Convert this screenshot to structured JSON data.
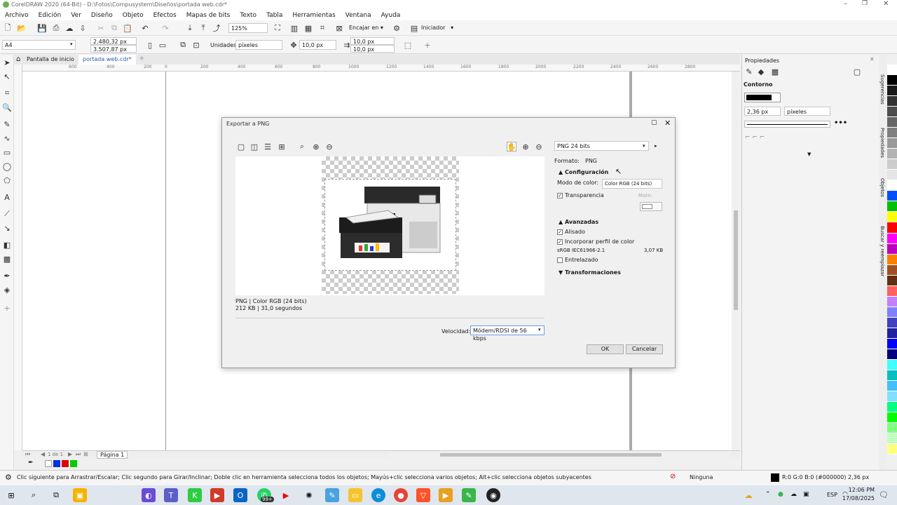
{
  "window": {
    "title": "CorelDRAW 2020 (64-Bit) - D:\\Fotos\\Compusystem\\Diseños\\portada web.cdr*"
  },
  "menu": [
    "Archivo",
    "Edición",
    "Ver",
    "Diseño",
    "Objeto",
    "Efectos",
    "Mapas de bits",
    "Texto",
    "Tabla",
    "Herramientas",
    "Ventana",
    "Ayuda"
  ],
  "toolbar1": {
    "zoom": "125%",
    "snap_label": "Encajar en",
    "launch_label": "Iniciador"
  },
  "toolbar2": {
    "page_size": "A4",
    "width": "2.480,32 px",
    "height": "3.507,87 px",
    "units_label": "Unidades:",
    "units_value": "píxeles",
    "nudge": "10,0 px",
    "dup_x": "10,0 px",
    "dup_y": "10,0 px"
  },
  "doc_tabs": {
    "home": "Pantalla de inicio",
    "doc": "portada web.cdr*"
  },
  "ruler_ticks": [
    "600",
    "400",
    "200",
    "0",
    "200",
    "400",
    "600",
    "800",
    "1000",
    "1200",
    "1400",
    "1600",
    "1800",
    "2000",
    "2200",
    "2400",
    "2600",
    "2800"
  ],
  "page_nav": {
    "counter": "1 de 1",
    "page_tab": "Página 1"
  },
  "properties": {
    "title": "Propiedades",
    "section": "Contorno",
    "width": "2,36 px",
    "unit": "píxeles",
    "side_tabs": [
      "Sugerencias",
      "Propiedades",
      "Objetos",
      "Buscar y reemplazar"
    ]
  },
  "dialog": {
    "title": "Exportar a PNG",
    "preset": "PNG 24 bits",
    "format_label": "Formato:",
    "format_value": "PNG",
    "config_title": "Configuración",
    "color_mode_label": "Modo de color:",
    "color_mode_value": "Color RGB (24 bits)",
    "transparency": "Transparencia",
    "matte": "Mate:",
    "advanced_title": "Avanzadas",
    "antialias": "Alisado",
    "embed_profile": "Incorporar perfil de color",
    "profile_name": "sRGB IEC61966-2.1",
    "profile_size": "3,07 KB",
    "interlaced": "Entrelazado",
    "transforms_title": "Transformaciones",
    "info_line1": "PNG  |  Color RGB (24 bits)",
    "info_line2": "212 KB  |  31,0 segundos",
    "speed_label": "Velocidad:",
    "speed_value": "Módem/RDSI de 56 kbps",
    "ok": "OK",
    "cancel": "Cancelar"
  },
  "status": {
    "hint": "Clic siguiente para Arrastrar/Escalar; Clic segundo para Girar/Inclinar; Doble clic en herramienta selecciona todos los objetos; Mayús+clic selecciona varios objetos; Alt+clic selecciona objetos subyacentes",
    "fill": "Ninguna",
    "outline": "R:0 G:0 B:0 (#000000)  2,36 px"
  },
  "taskbar": {
    "time": "12:06 PM",
    "date": "17/08/2025",
    "lang": "ESP",
    "badge": "99+"
  },
  "palette_colors": [
    "#ffffff",
    "#000000",
    "#1a1a1a",
    "#333333",
    "#4d4d4d",
    "#666666",
    "#808080",
    "#999999",
    "#b3b3b3",
    "#cccccc",
    "#e6e6e6",
    "#ffffff",
    "#0050ff",
    "#00c000",
    "#ffff00",
    "#ff0000",
    "#ff00ff",
    "#c000c0",
    "#ff8000",
    "#a05020",
    "#603010",
    "#ff6060",
    "#c080ff",
    "#8080ff",
    "#4040c0",
    "#2020a0",
    "#0000ff",
    "#000080",
    "#40ffff",
    "#00c0c0",
    "#40c0ff",
    "#80e0ff",
    "#00ff80",
    "#00ff00",
    "#80ff80",
    "#c0ffc0",
    "#ffff80"
  ]
}
